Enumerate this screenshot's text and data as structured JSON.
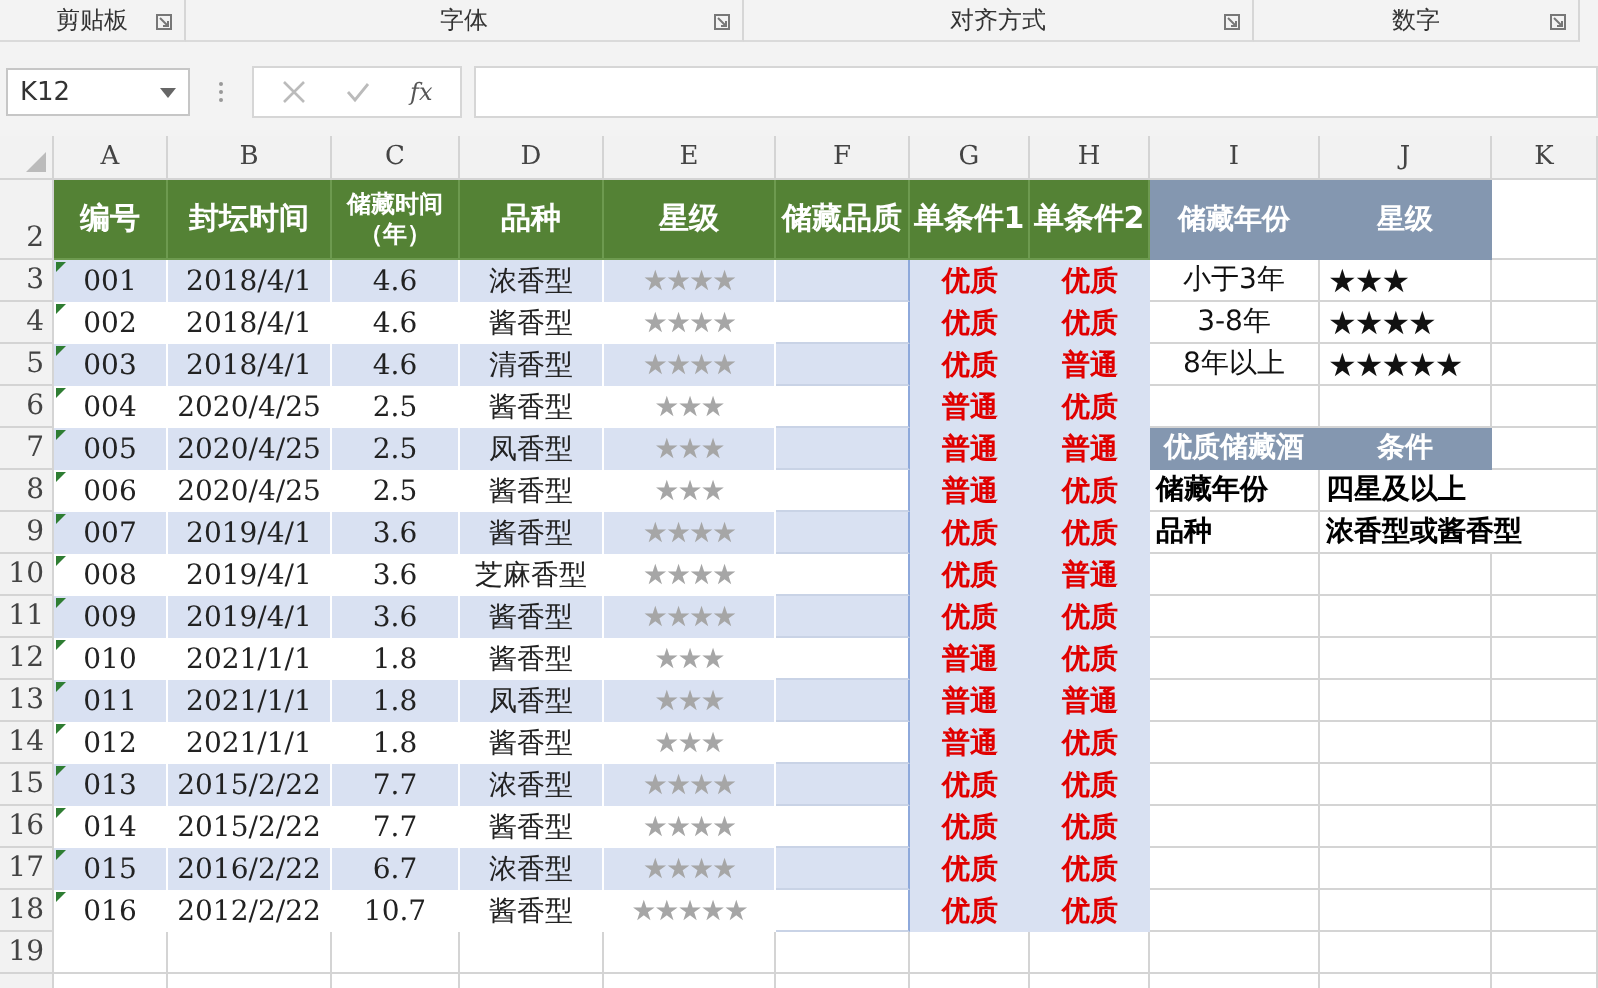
{
  "ribbon_groups": [
    {
      "label": "剪贴板"
    },
    {
      "label": "字体"
    },
    {
      "label": "对齐方式"
    },
    {
      "label": "数字"
    }
  ],
  "name_box": {
    "value": "K12"
  },
  "formula_bar": {
    "function_label": "fx"
  },
  "column_headers": [
    "A",
    "B",
    "C",
    "D",
    "E",
    "F",
    "G",
    "H",
    "I",
    "J",
    "K"
  ],
  "header_row": {
    "row_number": "2",
    "cells": [
      "编号",
      "封坛时间",
      "储藏时间（年）",
      "品种",
      "星级",
      "储藏品质",
      "单条件1",
      "单条件2"
    ]
  },
  "rows": [
    {
      "row_number": "3",
      "id": "001",
      "date": "2018/4/1",
      "years": "4.6",
      "type": "浓香型",
      "rating": "★★★★",
      "cond1": "优质",
      "cond2": "优质"
    },
    {
      "row_number": "4",
      "id": "002",
      "date": "2018/4/1",
      "years": "4.6",
      "type": "酱香型",
      "rating": "★★★★",
      "cond1": "优质",
      "cond2": "优质"
    },
    {
      "row_number": "5",
      "id": "003",
      "date": "2018/4/1",
      "years": "4.6",
      "type": "清香型",
      "rating": "★★★★",
      "cond1": "优质",
      "cond2": "普通"
    },
    {
      "row_number": "6",
      "id": "004",
      "date": "2020/4/25",
      "years": "2.5",
      "type": "酱香型",
      "rating": "★★★",
      "cond1": "普通",
      "cond2": "优质"
    },
    {
      "row_number": "7",
      "id": "005",
      "date": "2020/4/25",
      "years": "2.5",
      "type": "凤香型",
      "rating": "★★★",
      "cond1": "普通",
      "cond2": "普通"
    },
    {
      "row_number": "8",
      "id": "006",
      "date": "2020/4/25",
      "years": "2.5",
      "type": "酱香型",
      "rating": "★★★",
      "cond1": "普通",
      "cond2": "优质"
    },
    {
      "row_number": "9",
      "id": "007",
      "date": "2019/4/1",
      "years": "3.6",
      "type": "酱香型",
      "rating": "★★★★",
      "cond1": "优质",
      "cond2": "优质"
    },
    {
      "row_number": "10",
      "id": "008",
      "date": "2019/4/1",
      "years": "3.6",
      "type": "芝麻香型",
      "rating": "★★★★",
      "cond1": "优质",
      "cond2": "普通"
    },
    {
      "row_number": "11",
      "id": "009",
      "date": "2019/4/1",
      "years": "3.6",
      "type": "酱香型",
      "rating": "★★★★",
      "cond1": "优质",
      "cond2": "优质"
    },
    {
      "row_number": "12",
      "id": "010",
      "date": "2021/1/1",
      "years": "1.8",
      "type": "酱香型",
      "rating": "★★★",
      "cond1": "普通",
      "cond2": "优质"
    },
    {
      "row_number": "13",
      "id": "011",
      "date": "2021/1/1",
      "years": "1.8",
      "type": "凤香型",
      "rating": "★★★",
      "cond1": "普通",
      "cond2": "普通"
    },
    {
      "row_number": "14",
      "id": "012",
      "date": "2021/1/1",
      "years": "1.8",
      "type": "酱香型",
      "rating": "★★★",
      "cond1": "普通",
      "cond2": "优质"
    },
    {
      "row_number": "15",
      "id": "013",
      "date": "2015/2/22",
      "years": "7.7",
      "type": "浓香型",
      "rating": "★★★★",
      "cond1": "优质",
      "cond2": "优质"
    },
    {
      "row_number": "16",
      "id": "014",
      "date": "2015/2/22",
      "years": "7.7",
      "type": "酱香型",
      "rating": "★★★★",
      "cond1": "优质",
      "cond2": "优质"
    },
    {
      "row_number": "17",
      "id": "015",
      "date": "2016/2/22",
      "years": "6.7",
      "type": "浓香型",
      "rating": "★★★★",
      "cond1": "优质",
      "cond2": "优质"
    },
    {
      "row_number": "18",
      "id": "016",
      "date": "2012/2/22",
      "years": "10.7",
      "type": "酱香型",
      "rating": "★★★★★",
      "cond1": "优质",
      "cond2": "优质"
    }
  ],
  "empty_rows": [
    "19"
  ],
  "rating_table": {
    "header": [
      "储藏年份",
      "星级"
    ],
    "rows": [
      {
        "label": "小于3年",
        "rating": "★★★"
      },
      {
        "label": "3-8年",
        "rating": "★★★★"
      },
      {
        "label": "8年以上",
        "rating": "★★★★★"
      }
    ]
  },
  "criteria_table": {
    "header": [
      "优质储藏酒",
      "条件"
    ],
    "rows": [
      {
        "label": "储藏年份",
        "value": "四星及以上"
      },
      {
        "label": "品种",
        "value": "浓香型或酱香型"
      }
    ]
  }
}
